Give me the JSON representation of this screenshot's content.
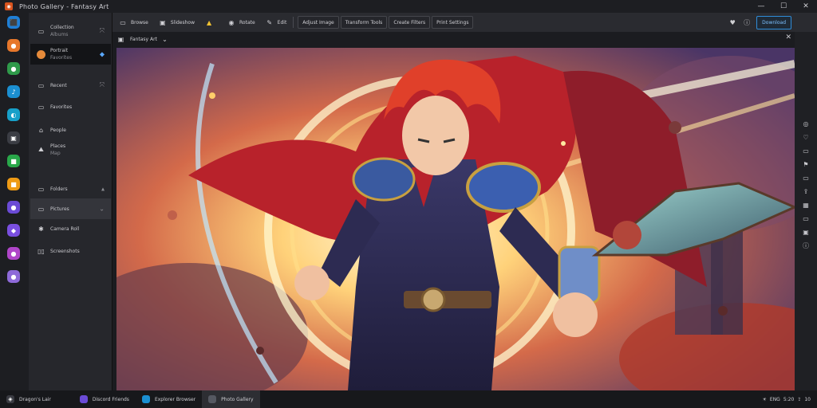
{
  "window": {
    "title": "Photo Gallery - Fantasy Art",
    "minimize": "—",
    "maximize": "☐",
    "close": "✕"
  },
  "rail_apps": [
    {
      "name": "store",
      "color": "#1f7fd6",
      "glyph": "⬛"
    },
    {
      "name": "firefox",
      "color": "#e7772b",
      "glyph": "●"
    },
    {
      "name": "chat",
      "color": "#2f9a4a",
      "glyph": "●"
    },
    {
      "name": "music",
      "color": "#1b8fd1",
      "glyph": "♪"
    },
    {
      "name": "edge",
      "color": "#17a0c9",
      "glyph": "◐"
    },
    {
      "name": "notes",
      "color": "#3b3d44",
      "glyph": "▣"
    },
    {
      "name": "app-green",
      "color": "#29a84a",
      "glyph": "■"
    },
    {
      "name": "app-orange",
      "color": "#ef9b15",
      "glyph": "■"
    },
    {
      "name": "app-purple",
      "color": "#6b4bd6",
      "glyph": "●"
    },
    {
      "name": "app-violet",
      "color": "#7a4fe0",
      "glyph": "◆"
    },
    {
      "name": "app-magenta",
      "color": "#b045c9",
      "glyph": "●"
    },
    {
      "name": "app-lilac",
      "color": "#8e6ad9",
      "glyph": "●"
    }
  ],
  "sidebar": {
    "items": [
      {
        "icon": "image-icon",
        "glyph": "▭",
        "label": "Collection",
        "sub": "Albums",
        "trail": "⤧"
      },
      {
        "icon": "avatar-icon",
        "glyph": "●",
        "label": "Portrait",
        "sub": "Favorites",
        "trail": "◆"
      },
      {
        "icon": "folder-icon",
        "glyph": "▭",
        "label": "Recent",
        "sub": "",
        "trail": "⤧"
      },
      {
        "icon": "folder-icon",
        "glyph": "▭",
        "label": "Favorites",
        "sub": "",
        "trail": ""
      },
      {
        "icon": "people-icon",
        "glyph": "⌂",
        "label": "People",
        "sub": "",
        "trail": ""
      },
      {
        "icon": "places-icon",
        "glyph": "⛰",
        "label": "Places",
        "sub": "Map",
        "trail": ""
      },
      {
        "icon": "folder-icon",
        "glyph": "▭",
        "label": "Folders",
        "sub": "",
        "trail": "▴"
      },
      {
        "icon": "pictures-icon",
        "glyph": "▭",
        "label": "Pictures",
        "sub": "",
        "trail": "⌄"
      },
      {
        "icon": "camera-icon",
        "glyph": "✱",
        "label": "Camera Roll",
        "sub": "",
        "trail": ""
      },
      {
        "icon": "book-icon",
        "glyph": "▯▯",
        "label": "Screenshots",
        "sub": "",
        "trail": ""
      }
    ]
  },
  "toolbar": {
    "buttons": [
      {
        "icon": "slideshow-icon",
        "glyph": "▭",
        "label": "Browse"
      },
      {
        "icon": "select-icon",
        "glyph": "▣",
        "label": "Slideshow"
      },
      {
        "icon": "folder-color-icon",
        "glyph": "▲",
        "label": ""
      },
      {
        "icon": "rotate-icon",
        "glyph": "◉",
        "label": "Rotate"
      },
      {
        "icon": "edit-icon",
        "glyph": "✎",
        "label": "Edit"
      }
    ],
    "tabs": [
      "Adjust Image",
      "Transform Tools",
      "Create Filters",
      "Print Settings"
    ],
    "right_icons": [
      {
        "icon": "heart-icon",
        "glyph": "♥"
      },
      {
        "icon": "info-icon",
        "glyph": "ⓘ"
      }
    ],
    "share_label": "Download"
  },
  "content": {
    "title": "Fantasy Art",
    "close": "✕"
  },
  "right_rail": [
    {
      "icon": "crop-icon",
      "glyph": "◎"
    },
    {
      "icon": "heart-outline-icon",
      "glyph": "♡"
    },
    {
      "icon": "layers-icon",
      "glyph": "▭"
    },
    {
      "icon": "flag-icon",
      "glyph": "⚑"
    },
    {
      "icon": "copy-icon",
      "glyph": "▭"
    },
    {
      "icon": "share-icon",
      "glyph": "⇪"
    },
    {
      "icon": "grid-icon",
      "glyph": "▦"
    },
    {
      "icon": "rect-icon",
      "glyph": "▭"
    },
    {
      "icon": "frame-icon",
      "glyph": "▣"
    },
    {
      "icon": "info-small-icon",
      "glyph": "ⓘ"
    }
  ],
  "taskbar": {
    "start_label": "Dragon's Lair",
    "tasks": [
      {
        "icon": "purple-app-icon",
        "color": "#6b4bd6",
        "label": "Discord Friends"
      },
      {
        "icon": "edge-app-icon",
        "color": "#1b8fd1",
        "label": "Explorer Browser"
      },
      {
        "icon": "gallery-app-icon",
        "color": "#555861",
        "label": "Photo Gallery"
      }
    ],
    "tray": [
      "☀",
      "ENG",
      "5:20",
      "⇪",
      "10"
    ]
  },
  "colors": {
    "accent": "#2f8cd8",
    "background": "#1b1c20"
  }
}
